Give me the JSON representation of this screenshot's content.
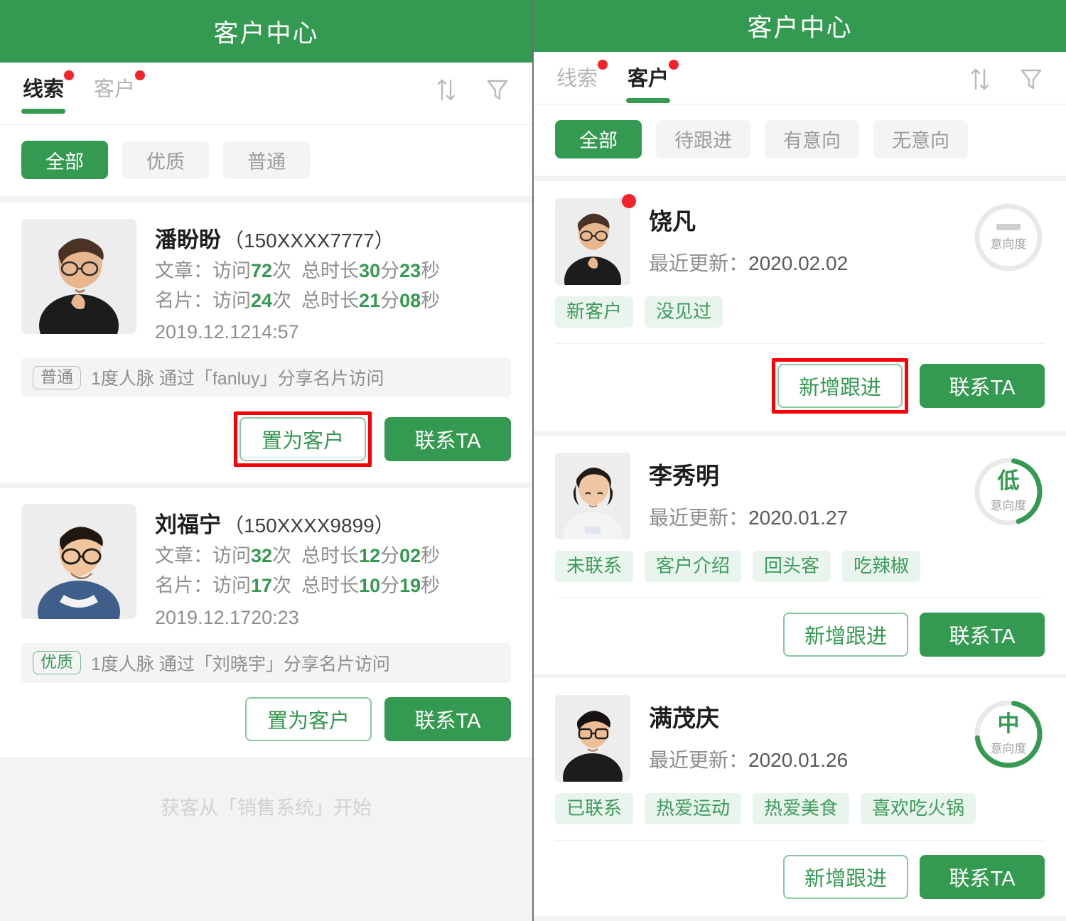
{
  "app": {
    "title": "客户中心",
    "brand_green": "#349a51",
    "tag_bg": "#e9f4ec",
    "badge_red": "#f5222d",
    "highlight_red": "#fb0007"
  },
  "left": {
    "header_title": "客户中心",
    "tabs": [
      {
        "label": "线索",
        "active": true,
        "badge": true
      },
      {
        "label": "客户",
        "active": false,
        "badge": true
      }
    ],
    "actions": [
      {
        "name": "sort-icon",
        "label": "sort-icon"
      },
      {
        "name": "filter-icon",
        "label": "filter-icon"
      }
    ],
    "chips": [
      {
        "label": "全部",
        "active": true
      },
      {
        "label": "优质",
        "active": false
      },
      {
        "label": "普通",
        "active": false
      }
    ],
    "leads": [
      {
        "name": "潘盼盼",
        "phone": "（150XXXX7777）",
        "stats": [
          {
            "label": "文章：",
            "visit_label": "访问",
            "visits": "72",
            "visits_unit": "次",
            "dur_label": "总时长",
            "minutes": "30",
            "min_unit": "分",
            "seconds": "23",
            "sec_unit": "秒"
          },
          {
            "label": "名片：",
            "visit_label": "访问",
            "visits": "24",
            "visits_unit": "次",
            "dur_label": "总时长",
            "minutes": "21",
            "min_unit": "分",
            "seconds": "08",
            "sec_unit": "秒"
          }
        ],
        "date": "2019.12.12",
        "time": "14:57",
        "grade": "普通",
        "grade_type": "normal",
        "source": "1度人脉  通过「fanluy」分享名片访问",
        "buttons": {
          "secondary": "置为客户",
          "primary": "联系TA"
        },
        "highlighted": true
      },
      {
        "name": "刘福宁",
        "phone": "（150XXXX9899）",
        "stats": [
          {
            "label": "文章：",
            "visit_label": "访问",
            "visits": "32",
            "visits_unit": "次",
            "dur_label": "总时长",
            "minutes": "12",
            "min_unit": "分",
            "seconds": "02",
            "sec_unit": "秒"
          },
          {
            "label": "名片：",
            "visit_label": "访问",
            "visits": "17",
            "visits_unit": "次",
            "dur_label": "总时长",
            "minutes": "10",
            "min_unit": "分",
            "seconds": "19",
            "sec_unit": "秒"
          }
        ],
        "date": "2019.12.17",
        "time": "20:23",
        "grade": "优质",
        "grade_type": "good",
        "source": "1度人脉  通过「刘晓宇」分享名片访问",
        "buttons": {
          "secondary": "置为客户",
          "primary": "联系TA"
        },
        "highlighted": false
      }
    ],
    "footer_text": "获客从「销售系统」开始"
  },
  "right": {
    "header_title": "客户中心",
    "tabs": [
      {
        "label": "线索",
        "active": false,
        "badge": true
      },
      {
        "label": "客户",
        "active": true,
        "badge": true
      }
    ],
    "chips": [
      {
        "label": "全部",
        "active": true
      },
      {
        "label": "待跟进",
        "active": false
      },
      {
        "label": "有意向",
        "active": false
      },
      {
        "label": "无意向",
        "active": false
      }
    ],
    "customers": [
      {
        "name": "饶凡",
        "updated_label": "最近更新：",
        "updated_date": "2020.02.02",
        "avatar_badge": true,
        "intent": {
          "level": "",
          "caption": "意向度",
          "percent": 0
        },
        "tags": [
          "新客户",
          "没见过"
        ],
        "buttons": {
          "secondary": "新增跟进",
          "primary": "联系TA"
        },
        "highlighted": true
      },
      {
        "name": "李秀明",
        "updated_label": "最近更新：",
        "updated_date": "2020.01.27",
        "avatar_badge": false,
        "intent": {
          "level": "低",
          "caption": "意向度",
          "percent": 42
        },
        "tags": [
          "未联系",
          "客户介绍",
          "回头客",
          "吃辣椒"
        ],
        "buttons": {
          "secondary": "新增跟进",
          "primary": "联系TA"
        },
        "highlighted": false
      },
      {
        "name": "满茂庆",
        "updated_label": "最近更新：",
        "updated_date": "2020.01.26",
        "avatar_badge": false,
        "intent": {
          "level": "中",
          "caption": "意向度",
          "percent": 70
        },
        "tags": [
          "已联系",
          "热爱运动",
          "热爱美食",
          "喜欢吃火锅"
        ],
        "buttons": {
          "secondary": "新增跟进",
          "primary": "联系TA"
        },
        "highlighted": false
      }
    ]
  }
}
